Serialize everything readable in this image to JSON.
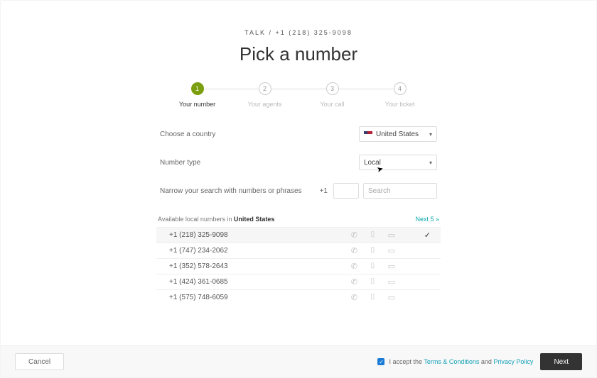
{
  "breadcrumb": "TALK / +1 (218) 325-9098",
  "title": "Pick a number",
  "steps": [
    {
      "n": "1",
      "label": "Your number",
      "active": true
    },
    {
      "n": "2",
      "label": "Your agents",
      "active": false
    },
    {
      "n": "3",
      "label": "Your call",
      "active": false
    },
    {
      "n": "4",
      "label": "Your ticket",
      "active": false
    }
  ],
  "form": {
    "country_label": "Choose a country",
    "country_value": "United States",
    "type_label": "Number type",
    "type_value": "Local",
    "narrow_label": "Narrow your search with numbers or phrases",
    "prefix": "+1",
    "area_value": "",
    "search_placeholder": "Search"
  },
  "table": {
    "header_pre": "Available local numbers in ",
    "header_bold": "United States",
    "next_label": "Next 5 »",
    "rows": [
      {
        "num": "+1 (218) 325-9098",
        "selected": true
      },
      {
        "num": "+1 (747) 234-2062",
        "selected": false
      },
      {
        "num": "+1 (352) 578-2643",
        "selected": false
      },
      {
        "num": "+1 (424) 361-0685",
        "selected": false
      },
      {
        "num": "+1 (575) 748-6059",
        "selected": false
      }
    ]
  },
  "footer": {
    "cancel": "Cancel",
    "accept_pre": "I accept the ",
    "terms": "Terms & Conditions",
    "and": " and ",
    "privacy": "Privacy Policy",
    "next": "Next"
  },
  "checkmark": "✓"
}
